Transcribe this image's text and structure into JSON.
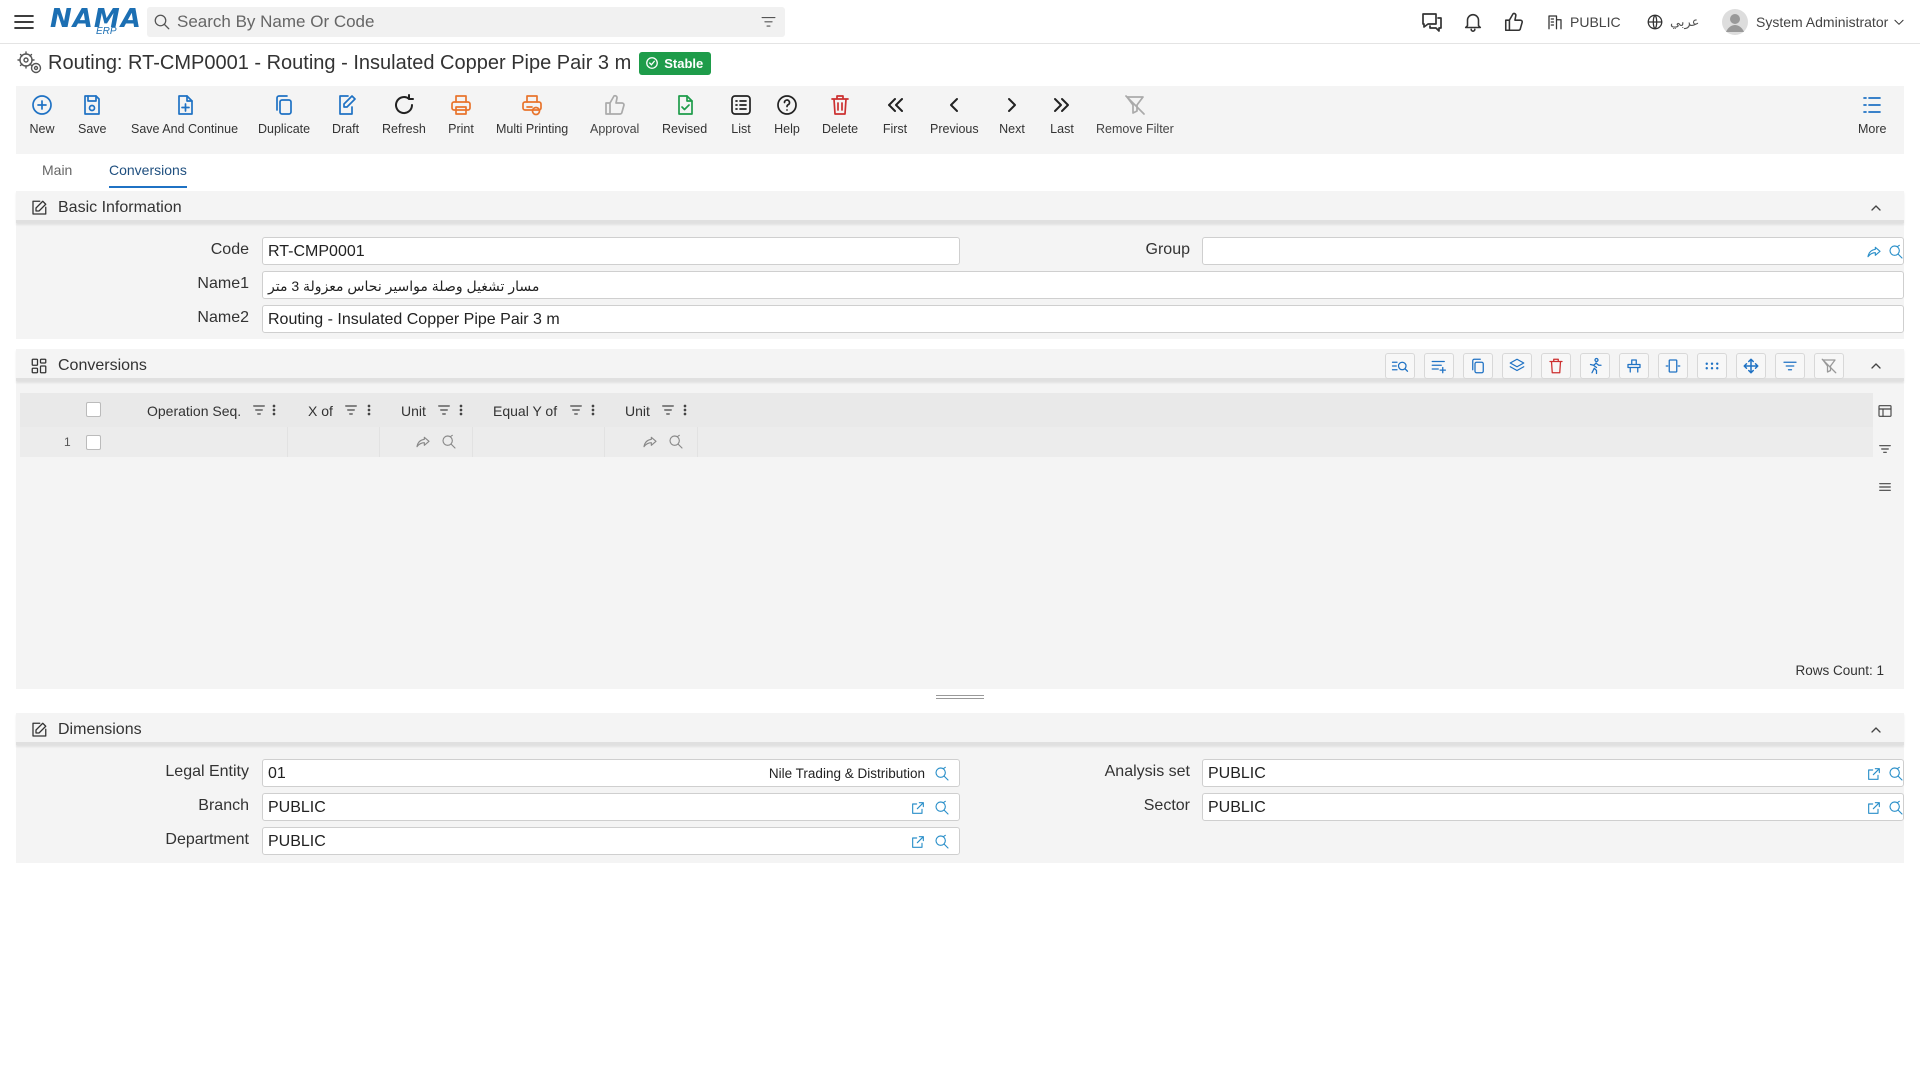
{
  "header": {
    "logo_text": "NAMA",
    "logo_sub": "ERP",
    "search_placeholder": "Search By Name Or Code",
    "company_label": "PUBLIC",
    "language_label": "عربي",
    "user_name": "System Administrator"
  },
  "page": {
    "title": "Routing: RT-CMP0001 - Routing - Insulated Copper Pipe Pair 3 m",
    "status": "Stable",
    "status_color": "#1e9c4a"
  },
  "toolbar": {
    "new": "New",
    "save": "Save",
    "save_continue": "Save And Continue",
    "duplicate": "Duplicate",
    "draft": "Draft",
    "refresh": "Refresh",
    "print": "Print",
    "multi_printing": "Multi Printing",
    "approval": "Approval",
    "revised": "Revised",
    "list": "List",
    "help": "Help",
    "delete": "Delete",
    "first": "First",
    "previous": "Previous",
    "next": "Next",
    "last": "Last",
    "remove_filter": "Remove Filter",
    "more": "More"
  },
  "tabs": {
    "main": "Main",
    "conversions": "Conversions",
    "active": "Conversions"
  },
  "basic_info": {
    "title": "Basic Information",
    "code_label": "Code",
    "code_value": "RT-CMP0001",
    "group_label": "Group",
    "group_value": "",
    "name1_label": "Name1",
    "name1_value": "مسار تشغيل وصلة مواسير نحاس معزولة 3 متر",
    "name2_label": "Name2",
    "name2_value": "Routing - Insulated Copper Pipe Pair 3 m"
  },
  "conversions": {
    "title": "Conversions",
    "columns": [
      "Operation Seq.",
      "X of",
      "Unit",
      "Equal Y of",
      "Unit"
    ],
    "rows": [
      {
        "index": "1",
        "operation_seq": "",
        "x_of": "",
        "unit": "",
        "equal_y_of": "",
        "unit2": ""
      }
    ],
    "rows_count_label": "Rows Count: 1"
  },
  "dimensions": {
    "title": "Dimensions",
    "legal_entity_label": "Legal Entity",
    "legal_entity_code": "01",
    "legal_entity_name": "Nile Trading & Distribution",
    "analysis_set_label": "Analysis set",
    "analysis_set_value": "PUBLIC",
    "branch_label": "Branch",
    "branch_value": "PUBLIC",
    "sector_label": "Sector",
    "sector_value": "PUBLIC",
    "department_label": "Department",
    "department_value": "PUBLIC"
  },
  "icons": {
    "accent_blue": "#1f72c4",
    "lookup_blue": "#2a8fc9",
    "print_orange": "#e8742c",
    "delete_red": "#cc2f2f"
  }
}
